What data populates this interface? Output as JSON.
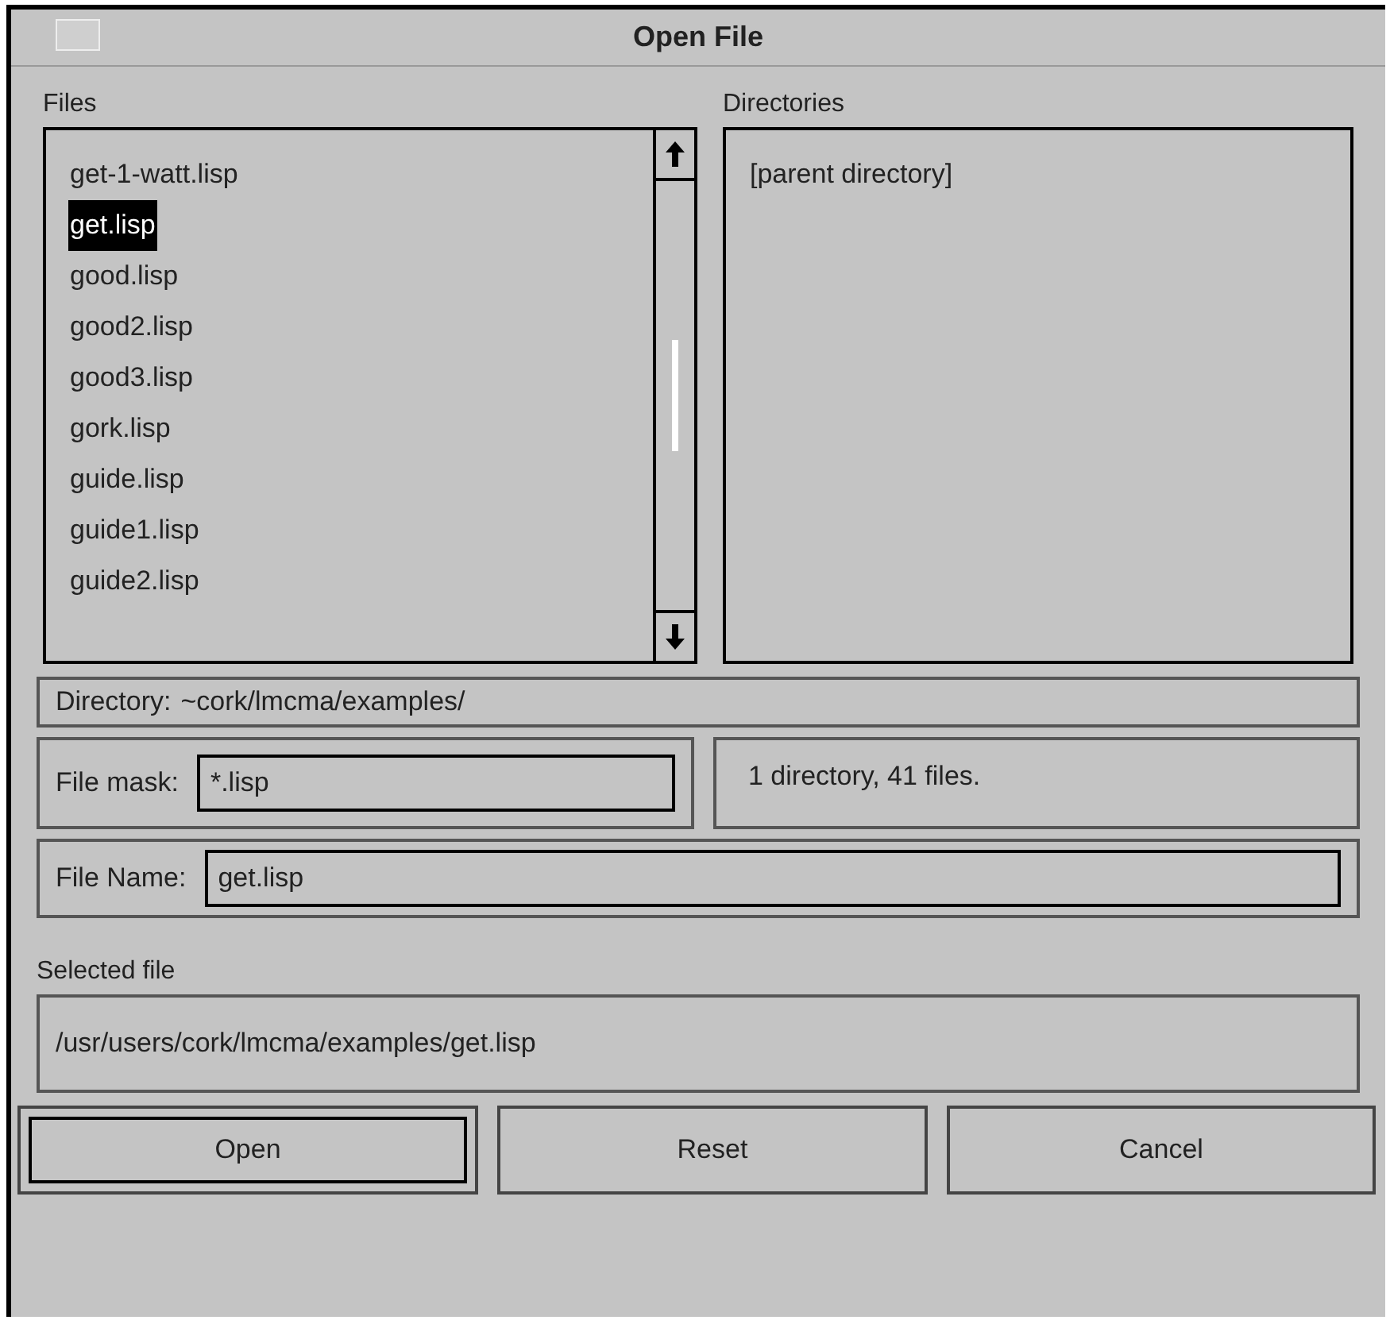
{
  "window": {
    "title": "Open File"
  },
  "files": {
    "label": "Files",
    "items": [
      {
        "label": "get-1-watt.lisp",
        "selected": false
      },
      {
        "label": "get.lisp",
        "selected": true
      },
      {
        "label": "good.lisp",
        "selected": false
      },
      {
        "label": "good2.lisp",
        "selected": false
      },
      {
        "label": "good3.lisp",
        "selected": false
      },
      {
        "label": "gork.lisp",
        "selected": false
      },
      {
        "label": "guide.lisp",
        "selected": false
      },
      {
        "label": "guide1.lisp",
        "selected": false
      },
      {
        "label": "guide2.lisp",
        "selected": false
      }
    ]
  },
  "directories": {
    "label": "Directories",
    "items": [
      {
        "label": "[parent directory]",
        "selected": false
      }
    ]
  },
  "directory": {
    "label": "Directory:",
    "value": "~cork/lmcma/examples/"
  },
  "file_mask": {
    "label": "File mask:",
    "value": "*.lisp"
  },
  "summary": "1 directory, 41 files.",
  "file_name": {
    "label": "File Name:",
    "value": "get.lisp"
  },
  "selected_file": {
    "label": "Selected file",
    "value": "/usr/users/cork/lmcma/examples/get.lisp"
  },
  "buttons": [
    {
      "label": "Open",
      "default": true
    },
    {
      "label": "Reset",
      "default": false
    },
    {
      "label": "Cancel",
      "default": false
    }
  ]
}
